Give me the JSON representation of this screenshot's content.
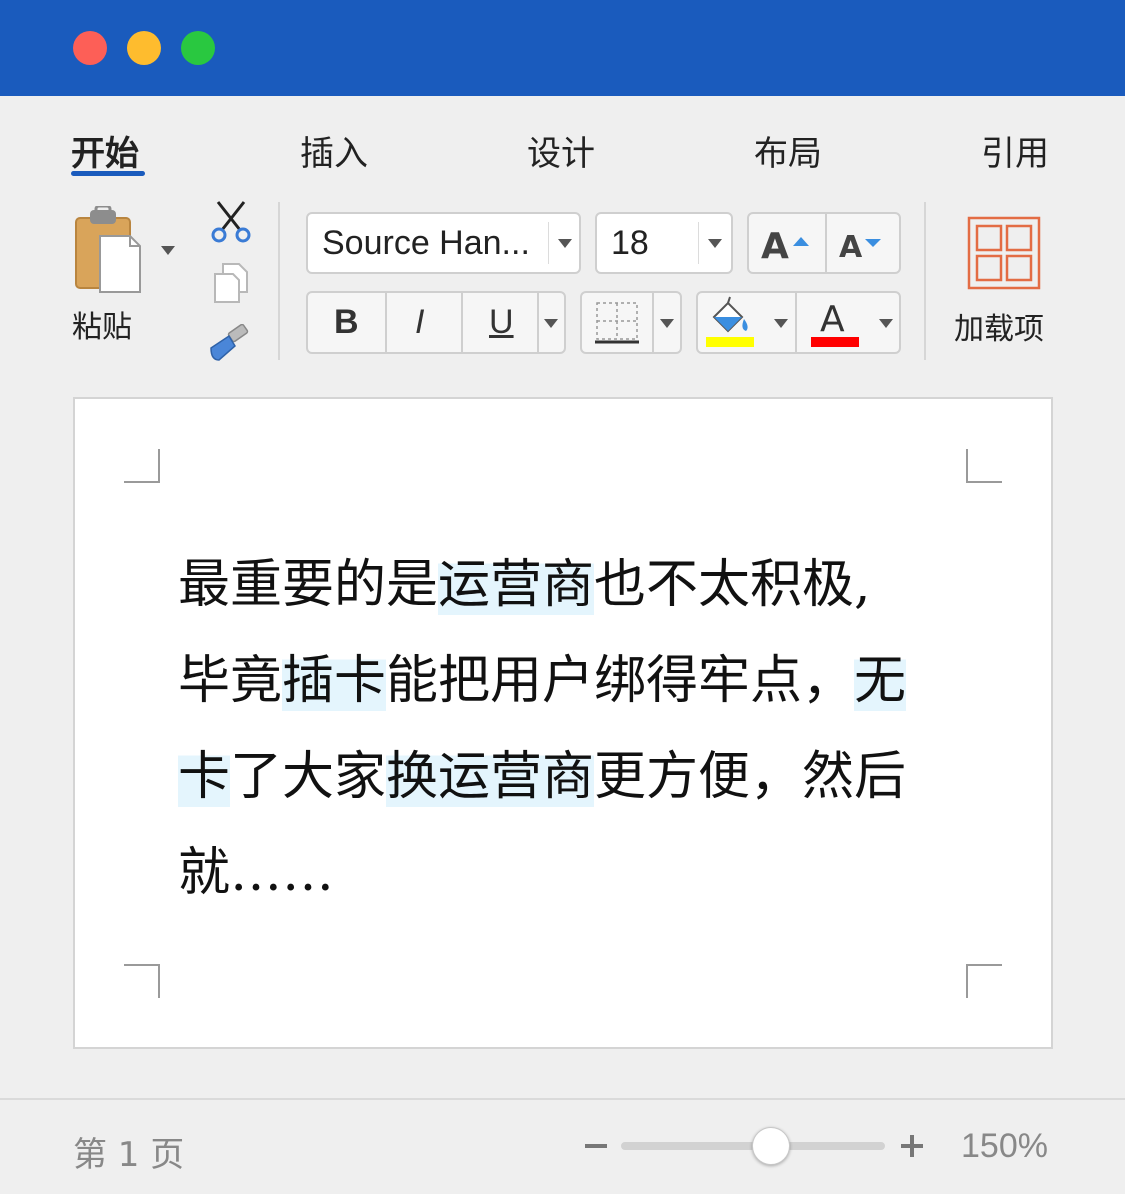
{
  "tabs": [
    {
      "label": "开始",
      "active": true
    },
    {
      "label": "插入"
    },
    {
      "label": "设计"
    },
    {
      "label": "布局"
    },
    {
      "label": "引用"
    }
  ],
  "clipboard": {
    "paste_label": "粘贴"
  },
  "font": {
    "family": "Source Han...",
    "size": "18"
  },
  "format_buttons": {
    "bold": "B",
    "italic": "I",
    "underline": "U"
  },
  "colors": {
    "titlebar": "#1a5bbd",
    "highlight": "#ffff00",
    "font_color": "#ff0000",
    "text_highlight_bg": "#e4f5fd"
  },
  "addins": {
    "label": "加载项"
  },
  "document": {
    "lines": [
      [
        {
          "t": "最重要的是"
        },
        {
          "t": "运营商",
          "hl": true
        },
        {
          "t": "也不太积极,"
        }
      ],
      [
        {
          "t": "毕竟"
        },
        {
          "t": "插卡",
          "hl": true
        },
        {
          "t": "能把用户绑得牢点，"
        },
        {
          "t": "无",
          "hl": true
        }
      ],
      [
        {
          "t": "卡",
          "hl": true
        },
        {
          "t": "了大家"
        },
        {
          "t": "换运营商",
          "hl": true
        },
        {
          "t": "更方便，然后"
        }
      ],
      [
        {
          "t": "就……"
        }
      ]
    ]
  },
  "status": {
    "page": "第 1 页",
    "zoom": "150%",
    "zoom_fraction": 0.5
  }
}
